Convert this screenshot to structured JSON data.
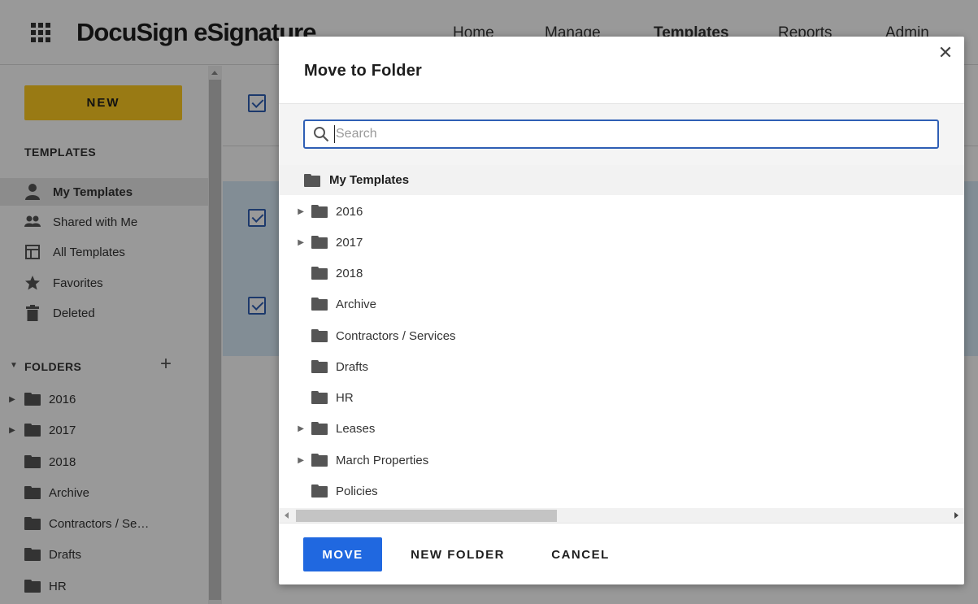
{
  "app": {
    "brand": "DocuSign eSignature",
    "nav": [
      "Home",
      "Manage",
      "Templates",
      "Reports",
      "Admin"
    ],
    "active_nav": "Templates"
  },
  "sidebar": {
    "new_label": "NEW",
    "templates_heading": "TEMPLATES",
    "items": [
      {
        "label": "My Templates",
        "icon": "person-icon"
      },
      {
        "label": "Shared with Me",
        "icon": "people-icon"
      },
      {
        "label": "All Templates",
        "icon": "template-icon"
      },
      {
        "label": "Favorites",
        "icon": "star-icon"
      },
      {
        "label": "Deleted",
        "icon": "trash-icon"
      }
    ],
    "folders_heading": "FOLDERS",
    "folders": [
      "2016",
      "2017",
      "2018",
      "Archive",
      "Contractors / Se…",
      "Drafts",
      "HR"
    ]
  },
  "modal": {
    "title": "Move to Folder",
    "close_icon": "close-icon",
    "search": {
      "placeholder": "Search",
      "value": ""
    },
    "root": "My Templates",
    "folders": [
      {
        "name": "2016",
        "expandable": true
      },
      {
        "name": "2017",
        "expandable": true
      },
      {
        "name": "2018",
        "expandable": false
      },
      {
        "name": "Archive",
        "expandable": false
      },
      {
        "name": "Contractors / Services",
        "expandable": false
      },
      {
        "name": "Drafts",
        "expandable": false
      },
      {
        "name": "HR",
        "expandable": false
      },
      {
        "name": "Leases",
        "expandable": true
      },
      {
        "name": "March Properties",
        "expandable": true
      },
      {
        "name": "Policies",
        "expandable": false
      }
    ],
    "buttons": {
      "move": "MOVE",
      "new_folder": "NEW FOLDER",
      "cancel": "CANCEL"
    }
  },
  "colors": {
    "primary": "#2068e0",
    "new_button": "#ffcc22",
    "focus_border": "#2f5fb5",
    "overlay": "rgba(0,0,0,0.4)"
  }
}
